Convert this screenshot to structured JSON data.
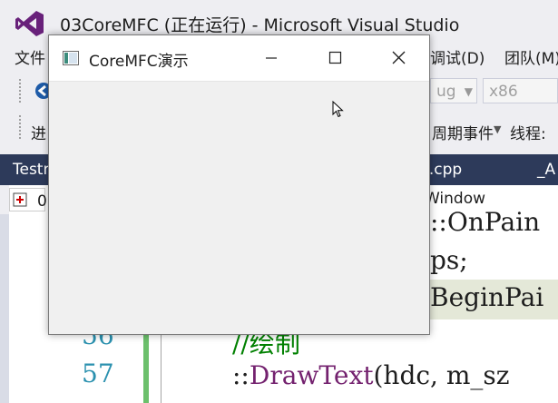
{
  "vs": {
    "window_title": "03CoreMFC (正在运行) - Microsoft Visual Studio",
    "menu": {
      "file": "文件",
      "debug": "调试(D)",
      "team": "团队(M)"
    },
    "toolbar": {
      "config_partial": "ug",
      "platform": "x86",
      "process_partial": "进",
      "lifecycle_events": "周期事件",
      "thread_label": "线程:"
    },
    "tabs": {
      "left": "Testr",
      "middle": "6.cpp",
      "right": "_A"
    },
    "nav": {
      "left_text": "0",
      "right_text": "Window"
    },
    "gutter": {
      "line56": "56",
      "line57": "57"
    },
    "code": {
      "line_a": "::OnPain",
      "line_b": "ps;",
      "line_c": "BeginPai",
      "line56": "//绘制",
      "line57_fn": "DrawText",
      "line57_rest": "(hdc, m_sz"
    }
  },
  "app_window": {
    "title": "CoreMFC演示"
  },
  "colors": {
    "vs_chrome": "#eeeef2",
    "tab_strip": "#2d3a5a",
    "vs_purple": "#68217a",
    "line_numbers": "#2b91af",
    "comment_green": "#008000",
    "function_purple": "#74226f",
    "change_bar": "#6cc06c"
  },
  "icons": [
    "visual-studio-logo-icon",
    "back-arrow-icon",
    "app-window-icon",
    "minimize-icon",
    "maximize-icon",
    "close-icon",
    "mouse-cursor-icon"
  ]
}
